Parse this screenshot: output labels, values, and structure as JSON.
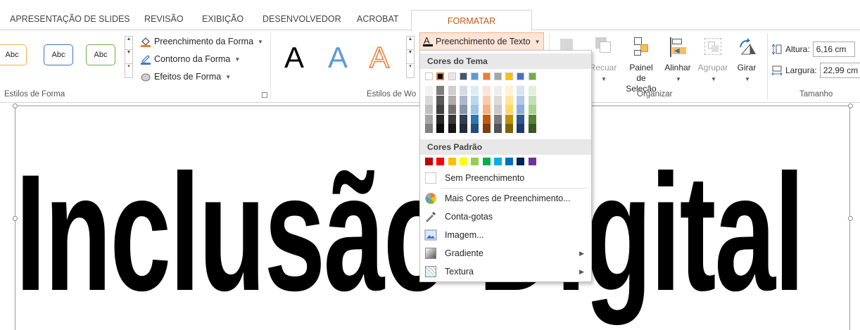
{
  "tabs": {
    "items": [
      {
        "label": "APRESENTAÇÃO DE SLIDES"
      },
      {
        "label": "REVISÃO"
      },
      {
        "label": "EXIBIÇÃO"
      },
      {
        "label": "DESENVOLVEDOR"
      },
      {
        "label": "ACROBAT"
      }
    ],
    "active": "FORMATAR"
  },
  "shape_styles": {
    "thumbs": [
      "Abc",
      "Abc",
      "Abc"
    ],
    "fill": "Preenchimento da Forma",
    "outline": "Contorno da Forma",
    "effects": "Efeitos de Forma",
    "group_label": "Estilos de Forma"
  },
  "wordart": {
    "letters": [
      "A",
      "A",
      "A"
    ],
    "text_fill_button": "Preenchimento de Texto",
    "group_label": "Estilos de Wo"
  },
  "arrange": {
    "buttons": [
      {
        "label": "Recuar"
      },
      {
        "label": "Painel de Seleção"
      },
      {
        "label": "Alinhar"
      },
      {
        "label": "Agrupar"
      },
      {
        "label": "Girar"
      }
    ],
    "group_label": "Organizar"
  },
  "size": {
    "height_label": "Altura:",
    "height_value": "6,16 cm",
    "width_label": "Largura:",
    "width_value": "22,99 cm",
    "group_label": "Tamanho"
  },
  "slide": {
    "text": "Inclusão Digital"
  },
  "menu": {
    "theme_header": "Cores do Tema",
    "standard_header": "Cores Padrão",
    "no_fill": "Sem Preenchimento",
    "more_colors": "Mais Cores de Preenchimento...",
    "eyedropper": "Conta-gotas",
    "picture": "Imagem...",
    "gradient": "Gradiente",
    "texture": "Textura"
  },
  "colors": {
    "accent": "#c55a11",
    "theme_top": [
      "#ffffff",
      "#000000",
      "#e7e6e6",
      "#44546a",
      "#5b9bd5",
      "#ed7d31",
      "#a5a5a5",
      "#ffc000",
      "#4472c4",
      "#70ad47"
    ],
    "theme_shades": [
      [
        "#f2f2f2",
        "#d9d9d9",
        "#bfbfbf",
        "#a6a6a6",
        "#808080"
      ],
      [
        "#7f7f7f",
        "#595959",
        "#3f3f3f",
        "#262626",
        "#0d0d0d"
      ],
      [
        "#d0cece",
        "#afabab",
        "#757171",
        "#3b3838",
        "#171616"
      ],
      [
        "#d6dce4",
        "#adb9ca",
        "#8497b0",
        "#333f4f",
        "#222a35"
      ],
      [
        "#ddebf7",
        "#bdd7ee",
        "#9dc3e6",
        "#2e75b6",
        "#1f4e79"
      ],
      [
        "#fbe5d6",
        "#f8cbad",
        "#f4b183",
        "#c55a11",
        "#843c0c"
      ],
      [
        "#ededed",
        "#dbdbdb",
        "#c9c9c9",
        "#7b7b7b",
        "#525252"
      ],
      [
        "#fff2cc",
        "#ffe699",
        "#ffd966",
        "#bf9000",
        "#7f6000"
      ],
      [
        "#dae3f3",
        "#b4c7e7",
        "#8faadc",
        "#2f5597",
        "#203864"
      ],
      [
        "#e2f0d9",
        "#c5e0b4",
        "#a9d18e",
        "#548235",
        "#385723"
      ]
    ],
    "standard": [
      "#c00000",
      "#ff0000",
      "#ffc000",
      "#ffff00",
      "#92d050",
      "#00b050",
      "#00b0f0",
      "#0070c0",
      "#002060",
      "#7030a0"
    ]
  }
}
